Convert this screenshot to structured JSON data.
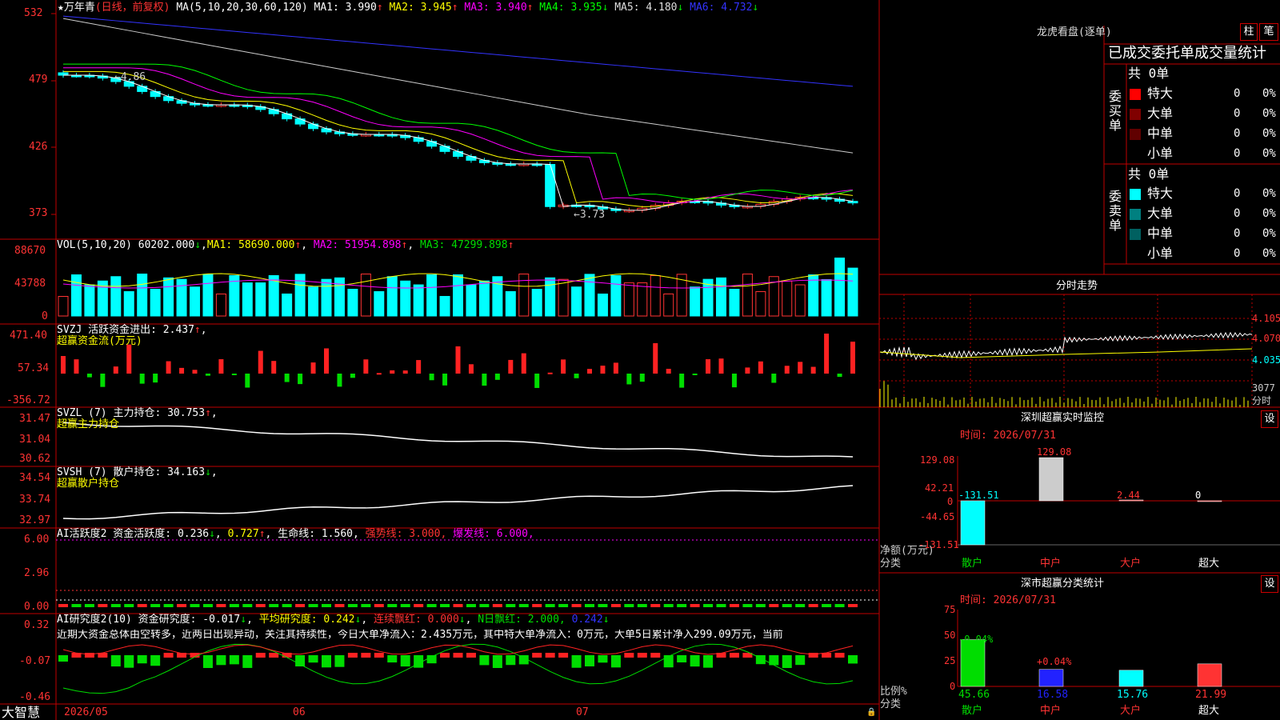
{
  "stock": {
    "star": "★",
    "name": "万年青",
    "period": "(日线，前复权)",
    "ma_label": "MA(5,10,20,30,60,120)"
  },
  "ma_values": [
    {
      "label": "MA1:",
      "value": "3.990",
      "arrow": "↑",
      "color": "#ffffff"
    },
    {
      "label": "MA2:",
      "value": "3.945",
      "arrow": "↑",
      "color": "#ffff00"
    },
    {
      "label": "MA3:",
      "value": "3.940",
      "arrow": "↑",
      "color": "#ff00ff"
    },
    {
      "label": "MA4:",
      "value": "3.935",
      "arrow": "↓",
      "color": "#00ff00"
    },
    {
      "label": "MA5:",
      "value": "4.180",
      "arrow": "↓",
      "color": "#dddddd"
    },
    {
      "label": "MA6:",
      "value": "4.732",
      "arrow": "↓",
      "color": "#3333ff"
    }
  ],
  "price_axis": [
    "532",
    "479",
    "426",
    "373"
  ],
  "price_annotations": {
    "high": "4.86",
    "low": "3.73"
  },
  "vol": {
    "label": "VOL(5,10,20)",
    "value": "60202.000",
    "arrow": "↓",
    "ma1": "MA1: 58690.000",
    "ma2": "MA2: 51954.898",
    "ma3": "MA3: 47299.898",
    "axis": [
      "88670",
      "43788",
      "0"
    ]
  },
  "svzj": {
    "label": "SVZJ  活跃资金进出: 2.437",
    "arrow": "↑",
    "sub": "超赢资金流(万元)",
    "axis": [
      "471.40",
      "57.34",
      "-356.72"
    ]
  },
  "svzl": {
    "label": "SVZL (7) 主力持仓: 30.753",
    "arrow": "↑",
    "sub": "超赢主力持仓",
    "axis": [
      "31.47",
      "31.04",
      "30.62"
    ]
  },
  "svsh": {
    "label": "SVSH (7) 散户持仓: 34.163",
    "arrow": "↓",
    "sub": "超赢散户持仓",
    "axis": [
      "34.54",
      "33.74",
      "32.97"
    ]
  },
  "ai_active": {
    "label": "AI活跃度2 资金活跃度: 0.236",
    "v2": "0.727",
    "life": "生命线: 1.560,",
    "strong": "强势线: 3.000,",
    "burst": "爆发线: 6.000,",
    "axis": [
      "6.00",
      "2.96",
      "0.00"
    ]
  },
  "ai_research": {
    "label": "AI研究度2(10) 资金研究度: -0.017",
    "avg": "平均研究度: 0.242",
    "lxph": "连续飘红: 0.000",
    "nph": "N日飘红: 2.000,",
    "last": "0.242",
    "axis": [
      "0.32",
      "-0.07",
      "-0.46"
    ],
    "comment": "近期大资金总体由空转多，近两日出现异动，关注其持续性，今日大单净流入：2.435万元，其中特大单净流入：0万元，大单5日累计净入299.09万元，当前"
  },
  "date_axis": {
    "brand": "大智慧",
    "labels": [
      "2026/05",
      "06",
      "07"
    ]
  },
  "longhu": {
    "title": "龙虎看盘(逐单)",
    "btn1": "柱",
    "btn2": "笔",
    "header": "已成交委托单成交量统计",
    "buy_group": "委买单",
    "sell_group": "委卖单",
    "buy_total": "共 0单",
    "sell_total": "共 0单",
    "buy_rows": [
      {
        "label": "特大",
        "count": "0",
        "pct": "0%",
        "color": "#ff0000"
      },
      {
        "label": "大单",
        "count": "0",
        "pct": "0%",
        "color": "#800000"
      },
      {
        "label": "中单",
        "count": "0",
        "pct": "0%",
        "color": "#600000"
      },
      {
        "label": "小单",
        "count": "0",
        "pct": "0%",
        "color": ""
      }
    ],
    "sell_rows": [
      {
        "label": "特大",
        "count": "0",
        "pct": "0%",
        "color": "#00ffff"
      },
      {
        "label": "大单",
        "count": "0",
        "pct": "0%",
        "color": "#008080"
      },
      {
        "label": "中单",
        "count": "0",
        "pct": "0%",
        "color": "#006060"
      },
      {
        "label": "小单",
        "count": "0",
        "pct": "0%",
        "color": ""
      }
    ]
  },
  "intraday": {
    "title": "分时走势",
    "axis": [
      "4.105",
      "4.070",
      "4.035"
    ],
    "vol_label": "3077",
    "vol_unit": "分时"
  },
  "monitor": {
    "title": "深圳超赢实时监控",
    "settings": "设",
    "time": "时间: 2026/07/31",
    "axis": [
      "129.08",
      "42.21",
      "0",
      "-44.65",
      "-131.51"
    ],
    "ylabel": [
      "净额(万元)",
      "分类"
    ],
    "categories": [
      "散户",
      "中户",
      "大户",
      "超大"
    ],
    "values": [
      -131.51,
      129.08,
      2.44,
      0
    ],
    "value_labels": [
      "-131.51",
      "129.08",
      "2.44",
      "0"
    ]
  },
  "classify": {
    "title": "深市超赢分类统计",
    "settings": "设",
    "time": "时间: 2026/07/31",
    "axis": [
      "75",
      "50",
      "25",
      "0"
    ],
    "ylabel": [
      "比例%",
      "分类"
    ],
    "categories": [
      "散户",
      "中户",
      "大户",
      "超大"
    ],
    "values": [
      45.66,
      16.58,
      15.76,
      21.99
    ],
    "deltas": [
      "-0.04%",
      "+0.04%",
      "",
      ""
    ],
    "value_labels": [
      "45.66",
      "16.58",
      "15.76",
      "21.99"
    ]
  },
  "colors": {
    "up": "#ff3333",
    "down": "#00ffff",
    "grid": "#c00000",
    "green": "#00dd00"
  }
}
